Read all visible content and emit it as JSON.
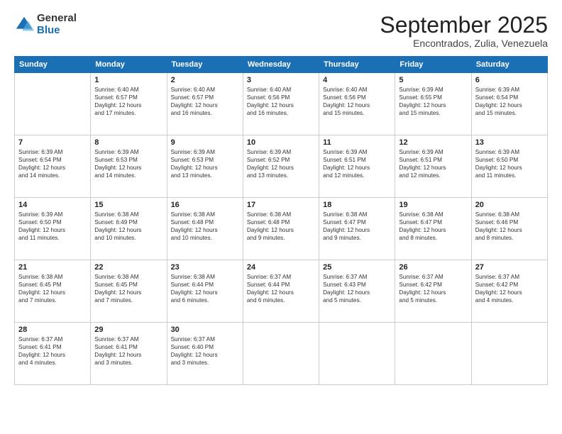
{
  "header": {
    "logo_general": "General",
    "logo_blue": "Blue",
    "month_title": "September 2025",
    "subtitle": "Encontrados, Zulia, Venezuela"
  },
  "days_of_week": [
    "Sunday",
    "Monday",
    "Tuesday",
    "Wednesday",
    "Thursday",
    "Friday",
    "Saturday"
  ],
  "weeks": [
    [
      {
        "day": "",
        "info": ""
      },
      {
        "day": "1",
        "info": "Sunrise: 6:40 AM\nSunset: 6:57 PM\nDaylight: 12 hours\nand 17 minutes."
      },
      {
        "day": "2",
        "info": "Sunrise: 6:40 AM\nSunset: 6:57 PM\nDaylight: 12 hours\nand 16 minutes."
      },
      {
        "day": "3",
        "info": "Sunrise: 6:40 AM\nSunset: 6:56 PM\nDaylight: 12 hours\nand 16 minutes."
      },
      {
        "day": "4",
        "info": "Sunrise: 6:40 AM\nSunset: 6:56 PM\nDaylight: 12 hours\nand 15 minutes."
      },
      {
        "day": "5",
        "info": "Sunrise: 6:39 AM\nSunset: 6:55 PM\nDaylight: 12 hours\nand 15 minutes."
      },
      {
        "day": "6",
        "info": "Sunrise: 6:39 AM\nSunset: 6:54 PM\nDaylight: 12 hours\nand 15 minutes."
      }
    ],
    [
      {
        "day": "7",
        "info": "Sunrise: 6:39 AM\nSunset: 6:54 PM\nDaylight: 12 hours\nand 14 minutes."
      },
      {
        "day": "8",
        "info": "Sunrise: 6:39 AM\nSunset: 6:53 PM\nDaylight: 12 hours\nand 14 minutes."
      },
      {
        "day": "9",
        "info": "Sunrise: 6:39 AM\nSunset: 6:53 PM\nDaylight: 12 hours\nand 13 minutes."
      },
      {
        "day": "10",
        "info": "Sunrise: 6:39 AM\nSunset: 6:52 PM\nDaylight: 12 hours\nand 13 minutes."
      },
      {
        "day": "11",
        "info": "Sunrise: 6:39 AM\nSunset: 6:51 PM\nDaylight: 12 hours\nand 12 minutes."
      },
      {
        "day": "12",
        "info": "Sunrise: 6:39 AM\nSunset: 6:51 PM\nDaylight: 12 hours\nand 12 minutes."
      },
      {
        "day": "13",
        "info": "Sunrise: 6:39 AM\nSunset: 6:50 PM\nDaylight: 12 hours\nand 11 minutes."
      }
    ],
    [
      {
        "day": "14",
        "info": "Sunrise: 6:39 AM\nSunset: 6:50 PM\nDaylight: 12 hours\nand 11 minutes."
      },
      {
        "day": "15",
        "info": "Sunrise: 6:38 AM\nSunset: 6:49 PM\nDaylight: 12 hours\nand 10 minutes."
      },
      {
        "day": "16",
        "info": "Sunrise: 6:38 AM\nSunset: 6:48 PM\nDaylight: 12 hours\nand 10 minutes."
      },
      {
        "day": "17",
        "info": "Sunrise: 6:38 AM\nSunset: 6:48 PM\nDaylight: 12 hours\nand 9 minutes."
      },
      {
        "day": "18",
        "info": "Sunrise: 6:38 AM\nSunset: 6:47 PM\nDaylight: 12 hours\nand 9 minutes."
      },
      {
        "day": "19",
        "info": "Sunrise: 6:38 AM\nSunset: 6:47 PM\nDaylight: 12 hours\nand 8 minutes."
      },
      {
        "day": "20",
        "info": "Sunrise: 6:38 AM\nSunset: 6:46 PM\nDaylight: 12 hours\nand 8 minutes."
      }
    ],
    [
      {
        "day": "21",
        "info": "Sunrise: 6:38 AM\nSunset: 6:45 PM\nDaylight: 12 hours\nand 7 minutes."
      },
      {
        "day": "22",
        "info": "Sunrise: 6:38 AM\nSunset: 6:45 PM\nDaylight: 12 hours\nand 7 minutes."
      },
      {
        "day": "23",
        "info": "Sunrise: 6:38 AM\nSunset: 6:44 PM\nDaylight: 12 hours\nand 6 minutes."
      },
      {
        "day": "24",
        "info": "Sunrise: 6:37 AM\nSunset: 6:44 PM\nDaylight: 12 hours\nand 6 minutes."
      },
      {
        "day": "25",
        "info": "Sunrise: 6:37 AM\nSunset: 6:43 PM\nDaylight: 12 hours\nand 5 minutes."
      },
      {
        "day": "26",
        "info": "Sunrise: 6:37 AM\nSunset: 6:42 PM\nDaylight: 12 hours\nand 5 minutes."
      },
      {
        "day": "27",
        "info": "Sunrise: 6:37 AM\nSunset: 6:42 PM\nDaylight: 12 hours\nand 4 minutes."
      }
    ],
    [
      {
        "day": "28",
        "info": "Sunrise: 6:37 AM\nSunset: 6:41 PM\nDaylight: 12 hours\nand 4 minutes."
      },
      {
        "day": "29",
        "info": "Sunrise: 6:37 AM\nSunset: 6:41 PM\nDaylight: 12 hours\nand 3 minutes."
      },
      {
        "day": "30",
        "info": "Sunrise: 6:37 AM\nSunset: 6:40 PM\nDaylight: 12 hours\nand 3 minutes."
      },
      {
        "day": "",
        "info": ""
      },
      {
        "day": "",
        "info": ""
      },
      {
        "day": "",
        "info": ""
      },
      {
        "day": "",
        "info": ""
      }
    ]
  ]
}
